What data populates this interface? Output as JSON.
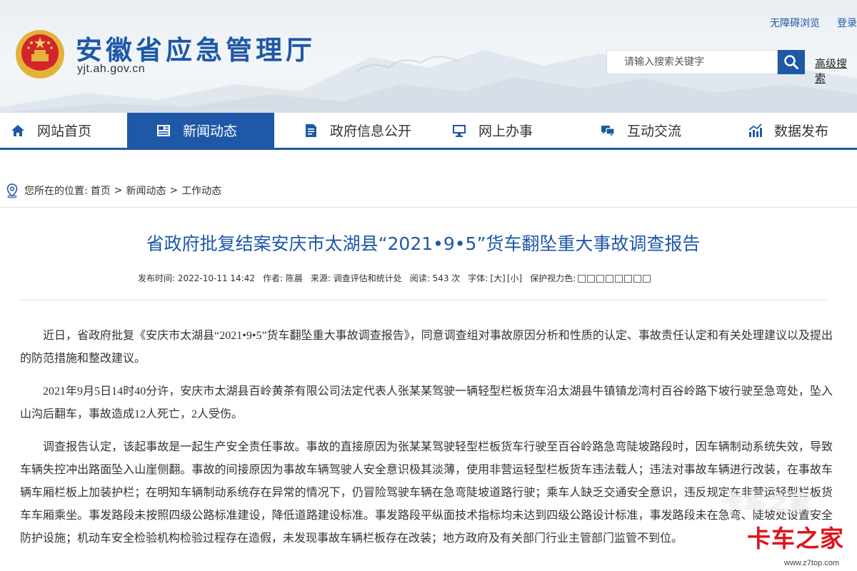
{
  "header": {
    "site_name": "安徽省应急管理厅",
    "site_domain": "yjt.ah.gov.cn",
    "top_links": [
      "无障碍浏览",
      "登录"
    ],
    "search": {
      "placeholder": "请输入搜索关键字"
    },
    "advanced_search": "高级搜索"
  },
  "nav": {
    "items": [
      {
        "label": "网站首页",
        "icon": "home-icon",
        "active": false
      },
      {
        "label": "新闻动态",
        "icon": "news-icon",
        "active": true
      },
      {
        "label": "政府信息公开",
        "icon": "document-icon",
        "active": false
      },
      {
        "label": "网上办事",
        "icon": "monitor-icon",
        "active": false
      },
      {
        "label": "互动交流",
        "icon": "chat-icon",
        "active": false
      },
      {
        "label": "数据发布",
        "icon": "chart-icon",
        "active": false
      }
    ]
  },
  "breadcrumb": {
    "prefix": "您所在的位置:",
    "items": [
      "首页",
      "新闻动态",
      "工作动态"
    ],
    "separator": ">"
  },
  "article": {
    "title": "省政府批复结案安庆市太湖县“2021•9•5”货车翻坠重大事故调查报告",
    "meta": {
      "publish_time": "发布时间: 2022-10-11 14:42",
      "author": "作者: 陈晨",
      "source": "来源: 调查评估和统计处",
      "views": "阅读: 543 次",
      "font_size_label": "字体:",
      "font_large": "[大]",
      "font_small": "[小]",
      "eye_care_label": "保护视力色:",
      "eye_care_colors": [
        "#ffffff",
        "#ffffff",
        "#ffffff",
        "#ffffff",
        "#ffffff",
        "#ffffff",
        "#ffffff",
        "#ffffff"
      ]
    },
    "paragraphs": [
      "近日，省政府批复《安庆市太湖县“2021•9•5”货车翻坠重大事故调查报告》，同意调查组对事故原因分析和性质的认定、事故责任认定和有关处理建议以及提出的防范措施和整改建议。",
      "2021年9月5日14时40分许，安庆市太湖县百岭黄茶有限公司法定代表人张某某驾驶一辆轻型栏板货车沿太湖县牛镇镇龙湾村百谷岭路下坡行驶至急弯处，坠入山沟后翻车，事故造成12人死亡，2人受伤。",
      "调查报告认定，该起事故是一起生产安全责任事故。事故的直接原因为张某某驾驶轻型栏板货车行驶至百谷岭路急弯陡坡路段时，因车辆制动系统失效，导致车辆失控冲出路面坠入山崖侧翻。事故的间接原因为事故车辆驾驶人安全意识极其淡薄，使用非营运轻型栏板货车违法载人；违法对事故车辆进行改装，在事故车辆车厢栏板上加装护栏；在明知车辆制动系统存在异常的情况下，仍冒险驾驶车辆在急弯陡坡道路行驶；乘车人缺乏交通安全意识，违反规定在非营运轻型栏板货车车厢乘坐。事发路段未按照四级公路标准建设，降低道路建设标准。事发路段平纵面技术指标均未达到四级公路设计标准，事发路段未在急弯、陡坡处设置安全防护设施；机动车安全检验机构检验过程存在造假，未发现事故车辆栏板存在改装；地方政府及有关部门行业主管部门监管不到位。"
    ]
  },
  "watermark": {
    "text_top": "卡车之家",
    "text_main": "卡车之家",
    "url": "www.z7top.com"
  },
  "colors": {
    "brand_blue": "#1e58a6",
    "watermark_red": "#e0141c"
  }
}
